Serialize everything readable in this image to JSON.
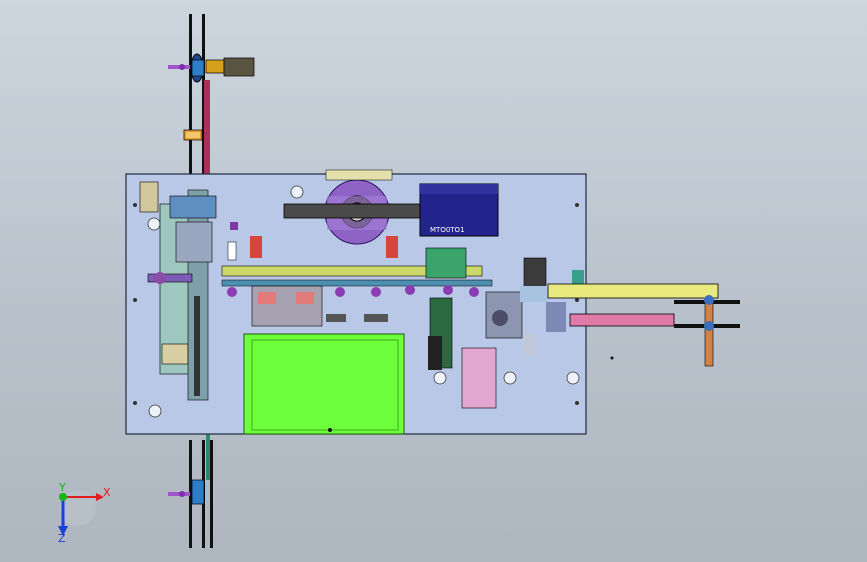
{
  "viewport": {
    "background_top": "#cdd5df",
    "background_bottom": "#aeb6bf"
  },
  "model": {
    "base_plate_color": "#b9c8e6",
    "feeder_plate_color": "#6cff3a",
    "motor_color": "#23238c",
    "reel_color": "#8f63c6",
    "arm_color": "#e8ea7e",
    "arm2_color": "#e07aa8",
    "motor_label": "MTO0TO1"
  },
  "triad": {
    "x_label": "X",
    "y_label": "Y",
    "z_label": "Z",
    "x_color": "#e21b1b",
    "y_color": "#17b317",
    "z_color": "#1c3fd6"
  }
}
